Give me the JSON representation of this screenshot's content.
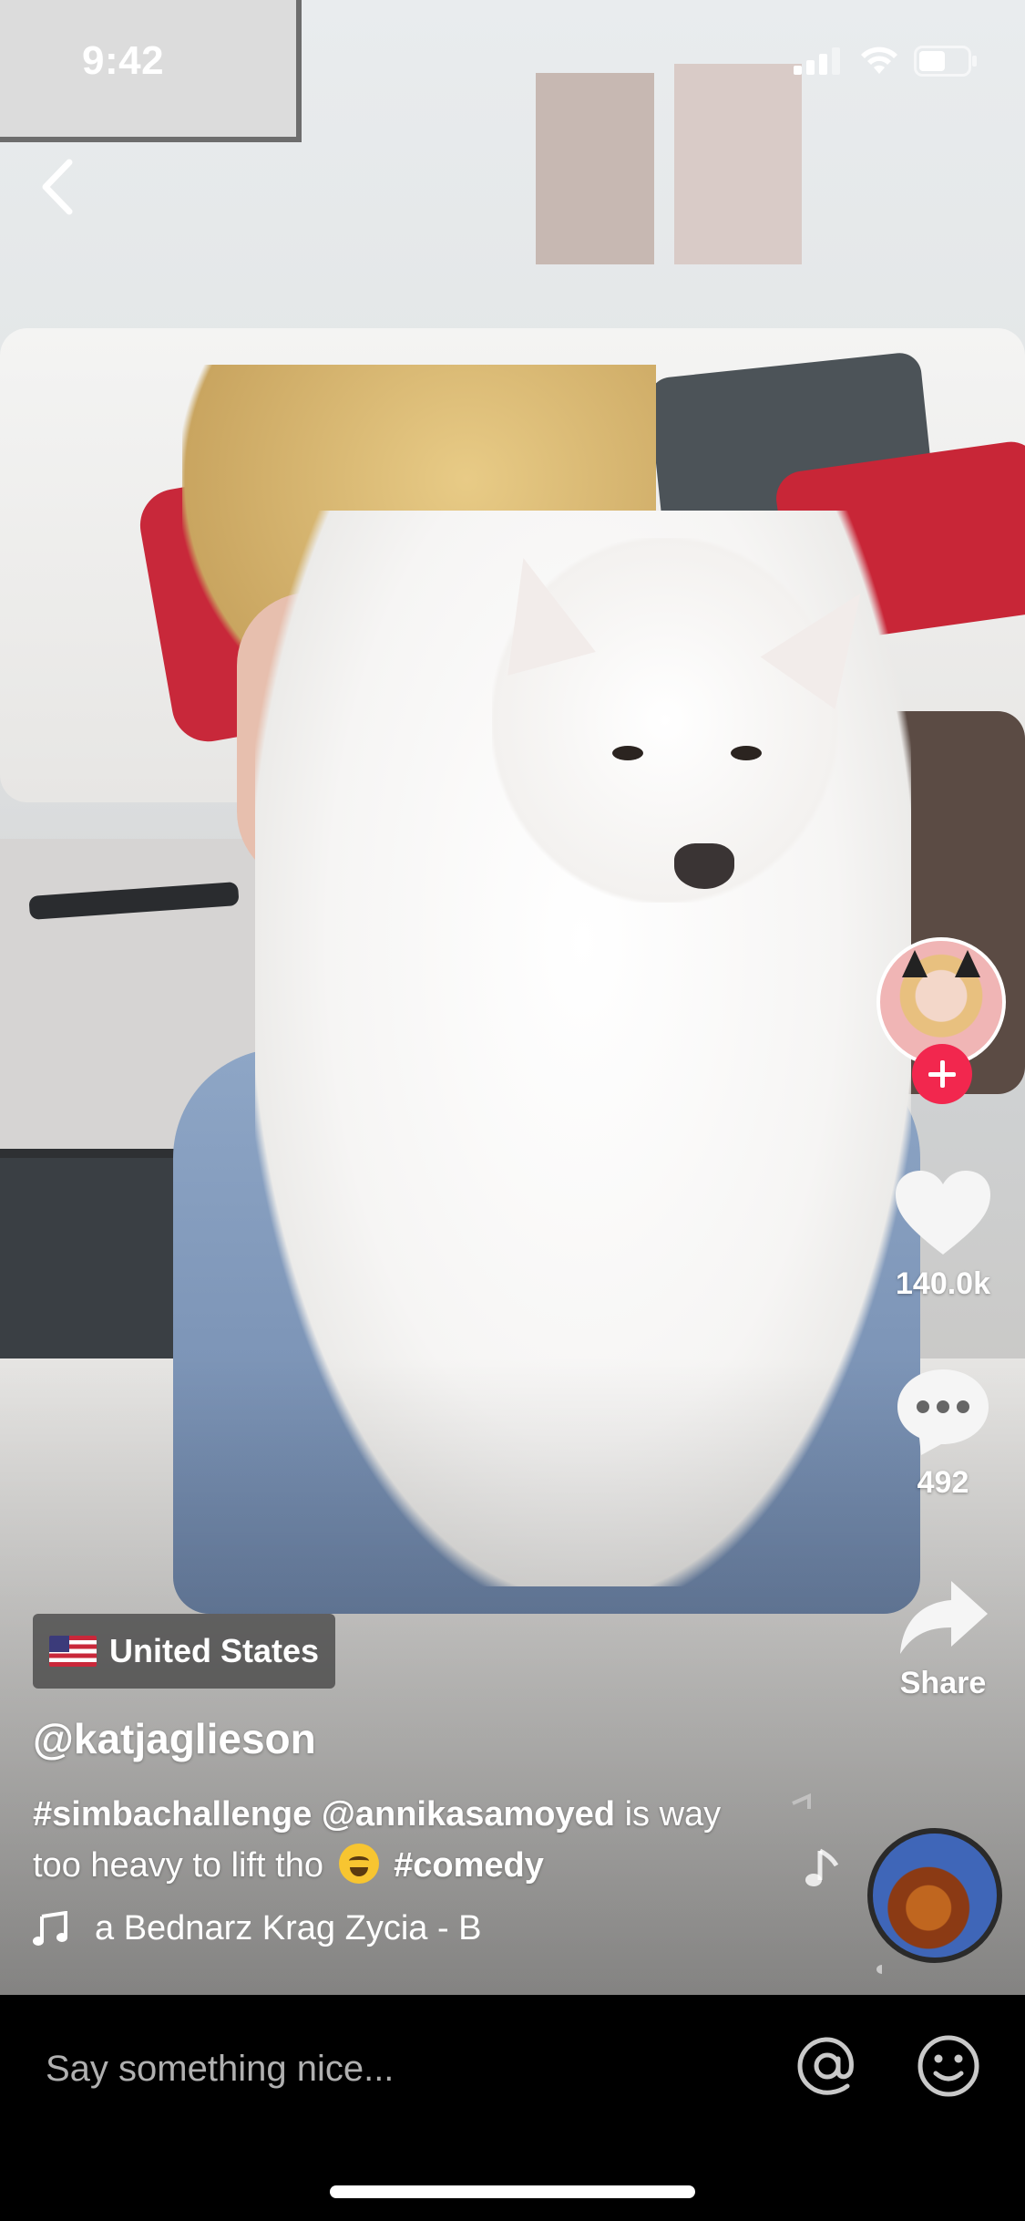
{
  "status_bar": {
    "time": "9:42"
  },
  "rail": {
    "likes": {
      "count": "140.0k",
      "icon": "heart-icon"
    },
    "comments": {
      "count": "492",
      "icon": "comment-bubble-icon"
    },
    "share": {
      "label": "Share",
      "icon": "share-arrow-icon"
    }
  },
  "post": {
    "region": {
      "label": "United States",
      "flag": "us-flag-icon"
    },
    "username": "@katjaglieson",
    "caption": {
      "hashtag_1": "#simbachallenge",
      "mention": "@annikasamoyed",
      "text": "is way too heavy to lift tho",
      "emoji": "😂",
      "hashtag_2": "#comedy"
    },
    "music": {
      "icon": "music-note-icon",
      "ticker": "a Bednarz    Krag Zycia - B"
    }
  },
  "comment_bar": {
    "placeholder": "Say something nice...",
    "mention_icon": "at-icon",
    "emoji_icon": "smiley-icon"
  },
  "colors": {
    "accent": "#f2274e",
    "text": "#ffffff",
    "bar_background": "#000000"
  }
}
